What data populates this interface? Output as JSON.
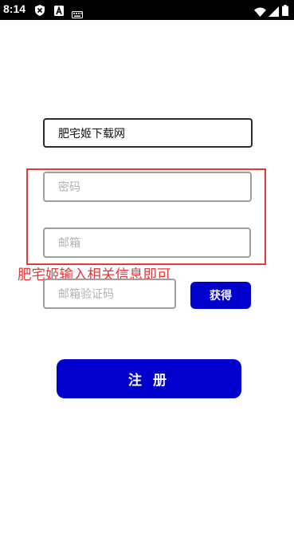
{
  "status_bar": {
    "time": "8:14",
    "icons": [
      "shield-icon",
      "a-box-icon",
      "keyboard-icon",
      "wifi-icon",
      "signal-icon",
      "battery-icon"
    ]
  },
  "form": {
    "username_value": "肥宅姬下载网",
    "password_placeholder": "密码",
    "email_placeholder": "邮箱",
    "code_placeholder": "邮箱验证码",
    "get_code_label": "获得",
    "register_label": "注 册"
  },
  "annotation": {
    "text": "肥宅姬输入相关信息即可",
    "color": "#e5393a"
  },
  "colors": {
    "primary_button": "#0000cc",
    "status_bar": "#000000"
  }
}
